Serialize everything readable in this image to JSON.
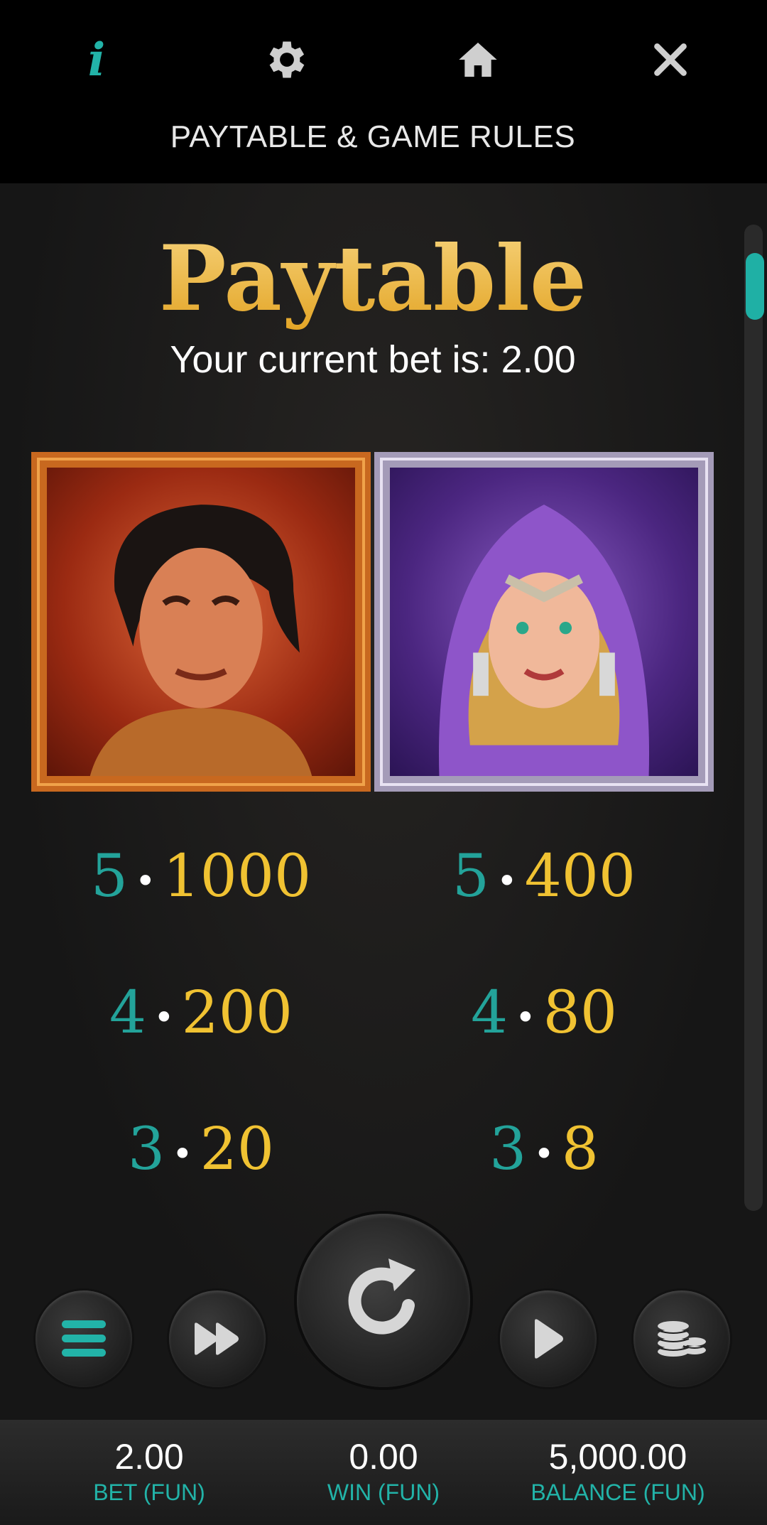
{
  "header": {
    "title": "PAYTABLE & GAME RULES",
    "icons": [
      "info-icon",
      "gear-icon",
      "home-icon",
      "close-icon"
    ],
    "info_glyph": "i"
  },
  "paytable": {
    "heading": "Paytable",
    "bet_text": "Your current bet is: 2.00",
    "symbols": [
      {
        "name": "warrior-symbol",
        "payouts": [
          {
            "count": "5",
            "amount": "1000"
          },
          {
            "count": "4",
            "amount": "200"
          },
          {
            "count": "3",
            "amount": "20"
          }
        ]
      },
      {
        "name": "priestess-symbol",
        "payouts": [
          {
            "count": "5",
            "amount": "400"
          },
          {
            "count": "4",
            "amount": "80"
          },
          {
            "count": "3",
            "amount": "8"
          }
        ]
      }
    ],
    "separator": "•"
  },
  "controls": {
    "buttons": [
      "menu-button",
      "fast-forward-button",
      "spin-button",
      "autoplay-button",
      "coins-button"
    ]
  },
  "footer": {
    "bet": {
      "value": "2.00",
      "label": "BET (FUN)"
    },
    "win": {
      "value": "0.00",
      "label": "WIN (FUN)"
    },
    "balance": {
      "value": "5,000.00",
      "label": "BALANCE (FUN)"
    }
  },
  "colors": {
    "accent_teal": "#22b3a8",
    "gold": "#f0c232",
    "background": "#161616"
  }
}
